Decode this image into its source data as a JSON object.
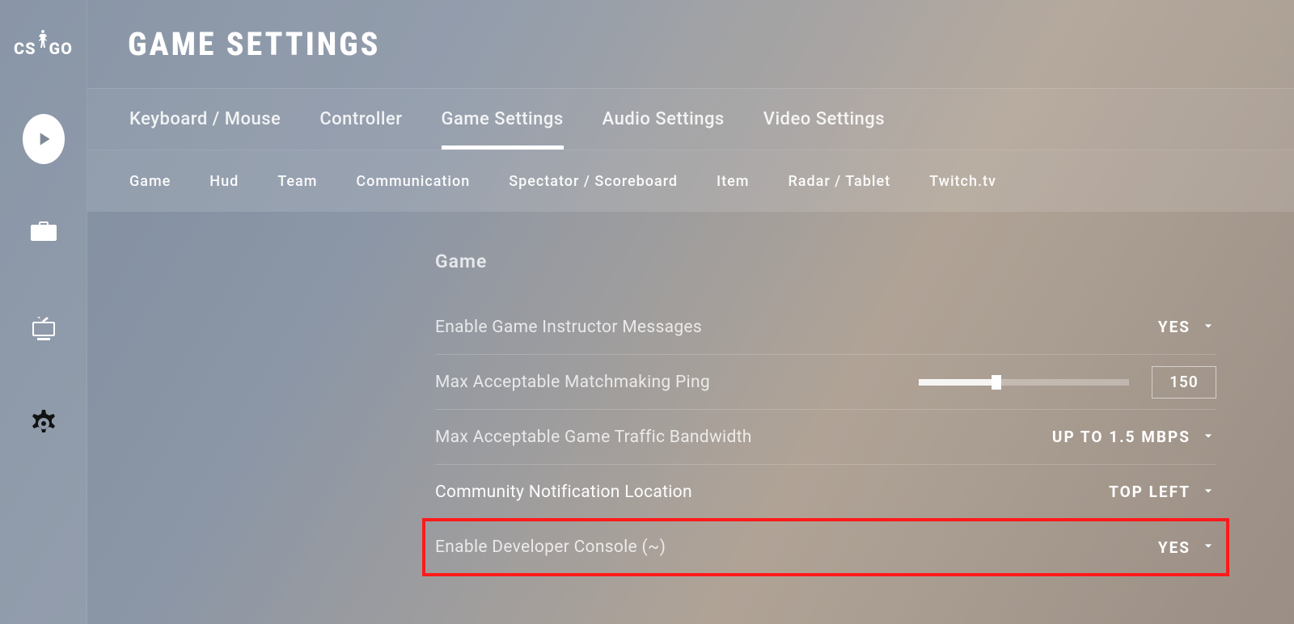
{
  "logo": {
    "left": "CS",
    "right": "GO"
  },
  "pageTitle": "GAME SETTINGS",
  "primaryTabs": [
    {
      "label": "Keyboard / Mouse",
      "active": false
    },
    {
      "label": "Controller",
      "active": false
    },
    {
      "label": "Game Settings",
      "active": true
    },
    {
      "label": "Audio Settings",
      "active": false
    },
    {
      "label": "Video Settings",
      "active": false
    }
  ],
  "subTabs": [
    {
      "label": "Game"
    },
    {
      "label": "Hud"
    },
    {
      "label": "Team"
    },
    {
      "label": "Communication"
    },
    {
      "label": "Spectator / Scoreboard"
    },
    {
      "label": "Item"
    },
    {
      "label": "Radar / Tablet"
    },
    {
      "label": "Twitch.tv"
    }
  ],
  "section": {
    "heading": "Game",
    "rows": [
      {
        "type": "dropdown",
        "label": "Enable Game Instructor Messages",
        "value": "YES"
      },
      {
        "type": "slider",
        "label": "Max Acceptable Matchmaking Ping",
        "value": "150",
        "percent": 37
      },
      {
        "type": "dropdown",
        "label": "Max Acceptable Game Traffic Bandwidth",
        "value": "UP TO 1.5 MBPS"
      },
      {
        "type": "dropdown",
        "label": "Community Notification Location",
        "value": "TOP LEFT",
        "bright": true
      },
      {
        "type": "dropdown",
        "label": "Enable Developer Console (~)",
        "value": "YES",
        "highlight": true
      }
    ]
  }
}
